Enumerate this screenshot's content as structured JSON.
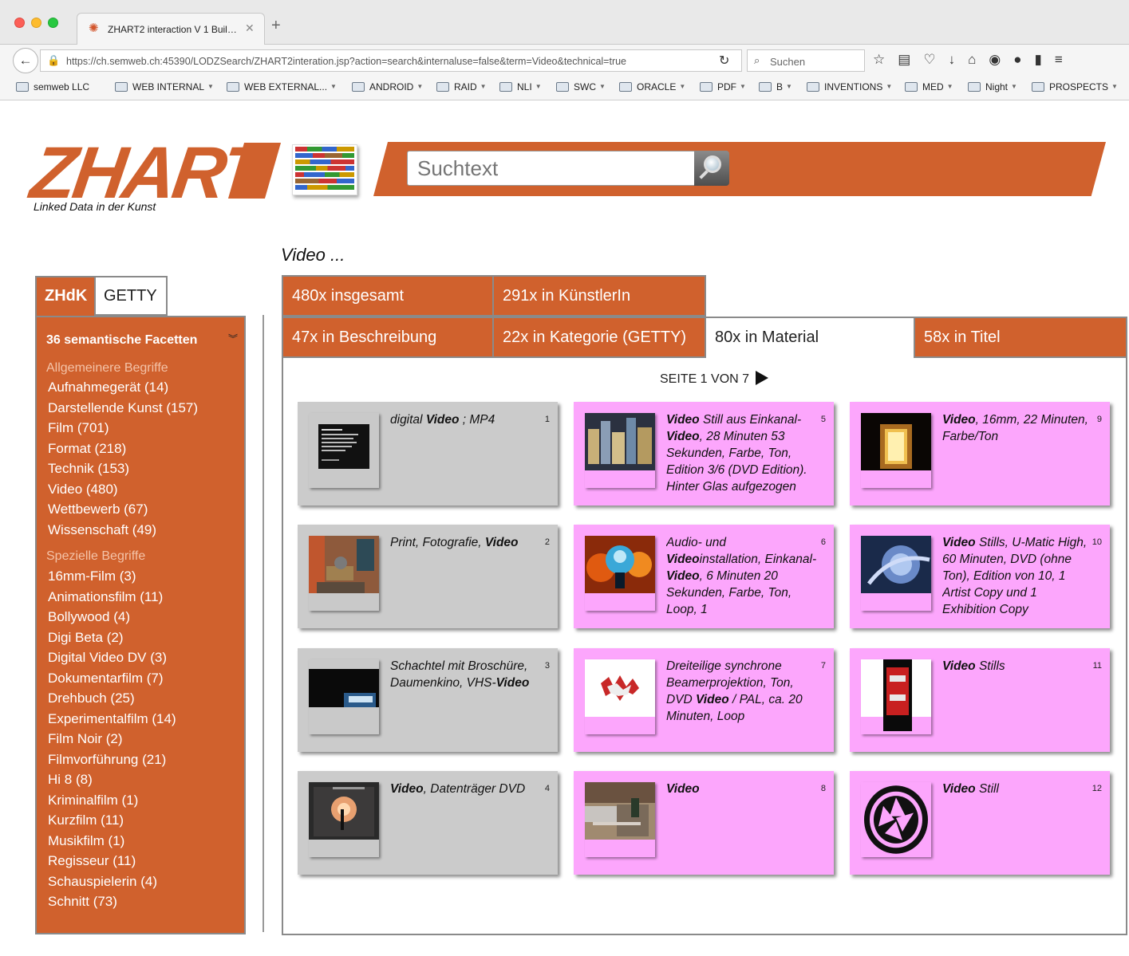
{
  "browser": {
    "tab_title": "ZHART2 interaction V 1 Buil…",
    "url": "https://ch.semweb.ch:45390/LODZSearch/ZHART2interation.jsp?action=search&internaluse=false&term=Video&technical=true",
    "search_placeholder": "Suchen",
    "bookmarks": [
      "semweb LLC",
      "WEB INTERNAL",
      "WEB EXTERNAL...",
      "ANDROID",
      "RAID",
      "NLI",
      "SWC",
      "ORACLE",
      "PDF",
      "B",
      "INVENTIONS",
      "MED",
      "Night",
      "PROSPECTS"
    ]
  },
  "header": {
    "logo": "ZHART",
    "tagline": "Linked Data in der Kunst",
    "search_placeholder": "Suchtext",
    "query_label": "Video ..."
  },
  "sidebar": {
    "tabs": [
      "ZHdK",
      "GETTY"
    ],
    "facets_title": "36 semantische Facetten",
    "general_heading": "Allgemeinere Begriffe",
    "general": [
      "Aufnahmegerät  (14)",
      "Darstellende Kunst  (157)",
      "Film  (701)",
      "Format  (218)",
      "Technik  (153)",
      "Video  (480)",
      "Wettbewerb  (67)",
      "Wissenschaft  (49)"
    ],
    "special_heading": "Spezielle Begriffe",
    "special": [
      "16mm-Film  (3)",
      "Animationsfilm  (11)",
      "Bollywood  (4)",
      "Digi Beta  (2)",
      "Digital Video DV  (3)",
      "Dokumentarfilm  (7)",
      "Drehbuch  (25)",
      "Experimentalfilm  (14)",
      "Film Noir  (2)",
      "Filmvorführung  (21)",
      "Hi 8  (8)",
      "Kriminalfilm  (1)",
      "Kurzfilm  (11)",
      "Musikfilm  (1)",
      "Regisseur  (11)",
      "Schauspielerin  (4)",
      "Schnitt  (73)"
    ]
  },
  "results": {
    "tabs_row1": [
      "480x insgesamt",
      "291x in KünstlerIn"
    ],
    "tabs_row2": [
      "47x in Beschreibung",
      "22x in Kategorie (GETTY)",
      "80x in Material",
      "58x in Titel"
    ],
    "active_tab": "80x in Material",
    "page_info": "SEITE 1 VON 7",
    "cards": [
      {
        "num": "1",
        "color": "gray",
        "html": "digital <b>Video</b> ; MP4"
      },
      {
        "num": "2",
        "color": "gray",
        "html": "Print, Fotografie, <b>Video</b>"
      },
      {
        "num": "3",
        "color": "gray",
        "html": "Schachtel mit Broschüre, Daumenkino, VHS-<b>Video</b>"
      },
      {
        "num": "4",
        "color": "gray",
        "html": "<b>Video</b>, Datenträger DVD"
      },
      {
        "num": "5",
        "color": "pink",
        "html": "<b>Video</b> Still aus Einkanal-<b>Video</b>, 28 Minuten 53 Sekunden, Farbe, Ton, Edition 3/6 (DVD Edition). Hinter Glas aufgezogen"
      },
      {
        "num": "6",
        "color": "pink",
        "html": "Audio- und <b>Video</b>installation, Einkanal-<b>Video</b>, 6 Minuten 20 Sekunden, Farbe, Ton, Loop, 1"
      },
      {
        "num": "7",
        "color": "pink",
        "html": "Dreiteilige synchrone Beamerprojektion, Ton, DVD <b>Video</b> / PAL, ca. 20 Minuten, Loop"
      },
      {
        "num": "8",
        "color": "pink",
        "html": "<b>Video</b>"
      },
      {
        "num": "9",
        "color": "pink",
        "html": "<b>Video</b>, 16mm, 22 Minuten, Farbe/Ton"
      },
      {
        "num": "10",
        "color": "pink",
        "html": "<b>Video</b> Stills, U-Matic High, 60 Minuten, DVD (ohne Ton), Edition von 10, 1 Artist Copy und 1 Exhibition Copy"
      },
      {
        "num": "11",
        "color": "pink",
        "html": "<b>Video</b> Stills"
      },
      {
        "num": "12",
        "color": "pink",
        "html": "<b>Video</b> Still"
      }
    ]
  },
  "colors": {
    "brand": "#d0612d",
    "card_gray": "#cbcbcb",
    "card_pink": "#fca6fc"
  }
}
